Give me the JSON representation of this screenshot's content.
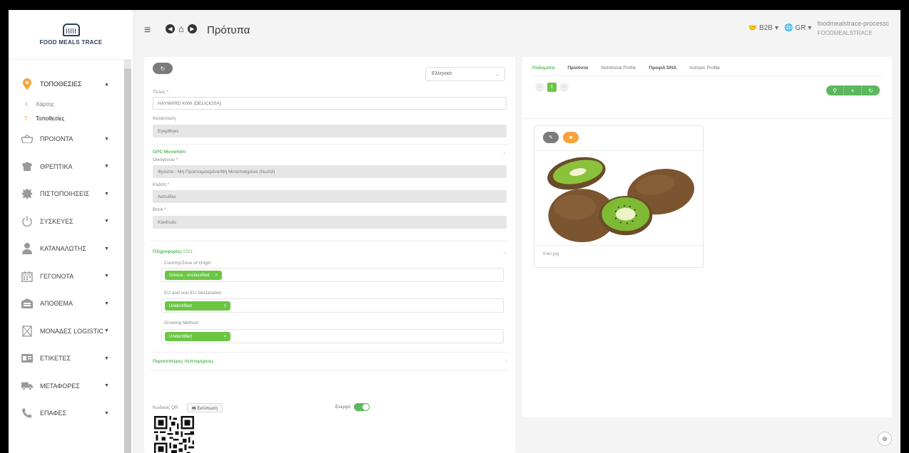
{
  "app": {
    "logo_text": "FOOD MEALS TRACE",
    "page_title": "Πρότυπα",
    "hamburger": "≡"
  },
  "header": {
    "b2b_label": "B2B",
    "lang_label": "GR",
    "user_name": "foodmealstrace-processc",
    "user_org": "FOODMEALSTRACE"
  },
  "sidebar": {
    "items": [
      {
        "label": "ΤΟΠΟΘΕΣΙΕΣ",
        "icon": "map-pin-icon",
        "expanded": true
      },
      {
        "label": "ΠΡΟΙΟΝΤΑ",
        "icon": "basket-icon"
      },
      {
        "label": "ΘΡΕΠΤΙΚΑ",
        "icon": "hat-icon"
      },
      {
        "label": "ΠΙΣΤΟΠΟΙΗΣΕΙΣ",
        "icon": "certificate-icon"
      },
      {
        "label": "ΣΥΣΚΕΥΕΣ",
        "icon": "power-icon"
      },
      {
        "label": "ΚΑΤΑΝΑΛΩΤΗΣ",
        "icon": "user-icon"
      },
      {
        "label": "ΓΕΓΟΝΟΤΑ",
        "icon": "calendar-icon"
      },
      {
        "label": "ΑΠΟΘΕΜΑ",
        "icon": "warehouse-icon"
      },
      {
        "label": "ΜΟΝΑΔΕΣ LOGISTIC",
        "icon": "box-x-icon"
      },
      {
        "label": "ΕΤΙΚΕΤΕΣ",
        "icon": "label-card-icon"
      },
      {
        "label": "ΜΕΤΑΦΟΡΕΣ",
        "icon": "truck-icon"
      },
      {
        "label": "ΕΠΑΦΕΣ",
        "icon": "phone-icon"
      }
    ],
    "subitems": [
      {
        "letter": "X",
        "label": "Χάρτης"
      },
      {
        "letter": "T",
        "label": "Τοποθεσίες"
      }
    ]
  },
  "form": {
    "language_select": "Ελληνικά",
    "title_label": "Τίτλος *",
    "title_value": "HAYWARD KIWI (DELICIOSA)",
    "status_label": "Κατάσταση",
    "status_value": "Εγκρίθηκε",
    "gpc_section": "GPC Μοναπάτι",
    "family_label": "Οικογένεια *",
    "family_value": "Φρούτα - Μη Προετοιμασμένα/Μη Μεταποιημένα (Νωπά)",
    "class_label": "Κλάση *",
    "class_value": "Ακτινίδια",
    "brick_label": "Brick *",
    "brick_value": "Kiwifruits",
    "gs1_section_bold": "Πληροφορίες",
    "gs1_section_rest": " GS1",
    "origin_label": "Country/Zone of Origin",
    "origin_tag": "Greece - unclassified",
    "eu_label": "EU and non-EU Declaration",
    "eu_tag": "Unidentified",
    "growing_label": "Growing Method",
    "growing_tag": "Unidentified",
    "more_details": "Περισσότερες Λεπτομέρειες",
    "qr_label": "Κωδικός QR",
    "print_label": "Εκτύπωση",
    "active_label": "Ενεργό",
    "active": true
  },
  "right_panel": {
    "tabs": [
      "Πολυμέσα",
      "Προϊόντα",
      "Nutritional Profile",
      "Προφίλ DNA",
      "Isotopic Profile"
    ],
    "active_tab": 0,
    "pager": {
      "prev": "‹",
      "current": "1",
      "next": "›"
    },
    "card_filename": "Kiwi.jpg"
  },
  "colors": {
    "accent_green": "#5bb85d",
    "tag_green": "#6cc644",
    "orange": "#f7a33b",
    "gray_button": "#7b7b7b"
  }
}
